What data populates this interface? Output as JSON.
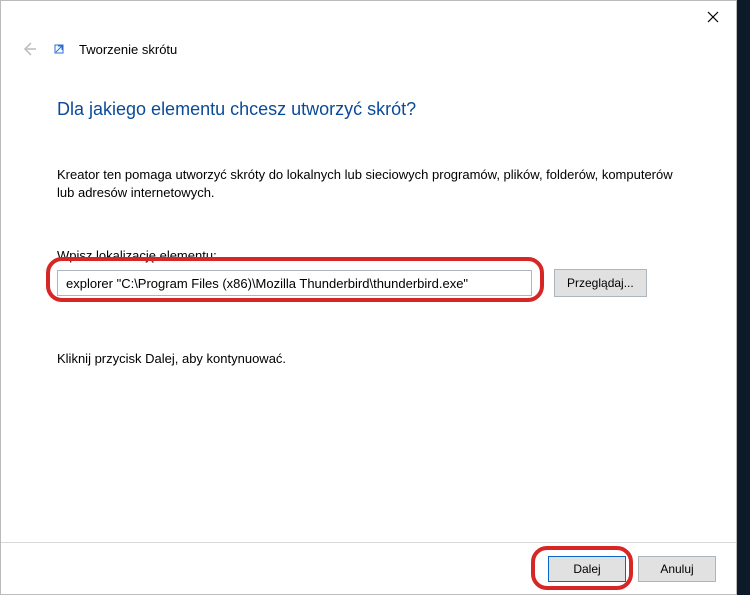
{
  "header": {
    "wizard_title": "Tworzenie skrótu"
  },
  "content": {
    "headline": "Dla jakiego elementu chcesz utworzyć skrót?",
    "description": "Kreator ten pomaga utworzyć skróty do lokalnych lub sieciowych programów, plików, folderów, komputerów lub adresów internetowych.",
    "location_label": "Wpisz lokalizację elementu:",
    "path_value": "explorer \"C:\\Program Files (x86)\\Mozilla Thunderbird\\thunderbird.exe\"",
    "browse_label": "Przeglądaj...",
    "continue_label": "Kliknij przycisk Dalej, aby kontynuować."
  },
  "footer": {
    "next_label": "Dalej",
    "cancel_label": "Anuluj"
  }
}
